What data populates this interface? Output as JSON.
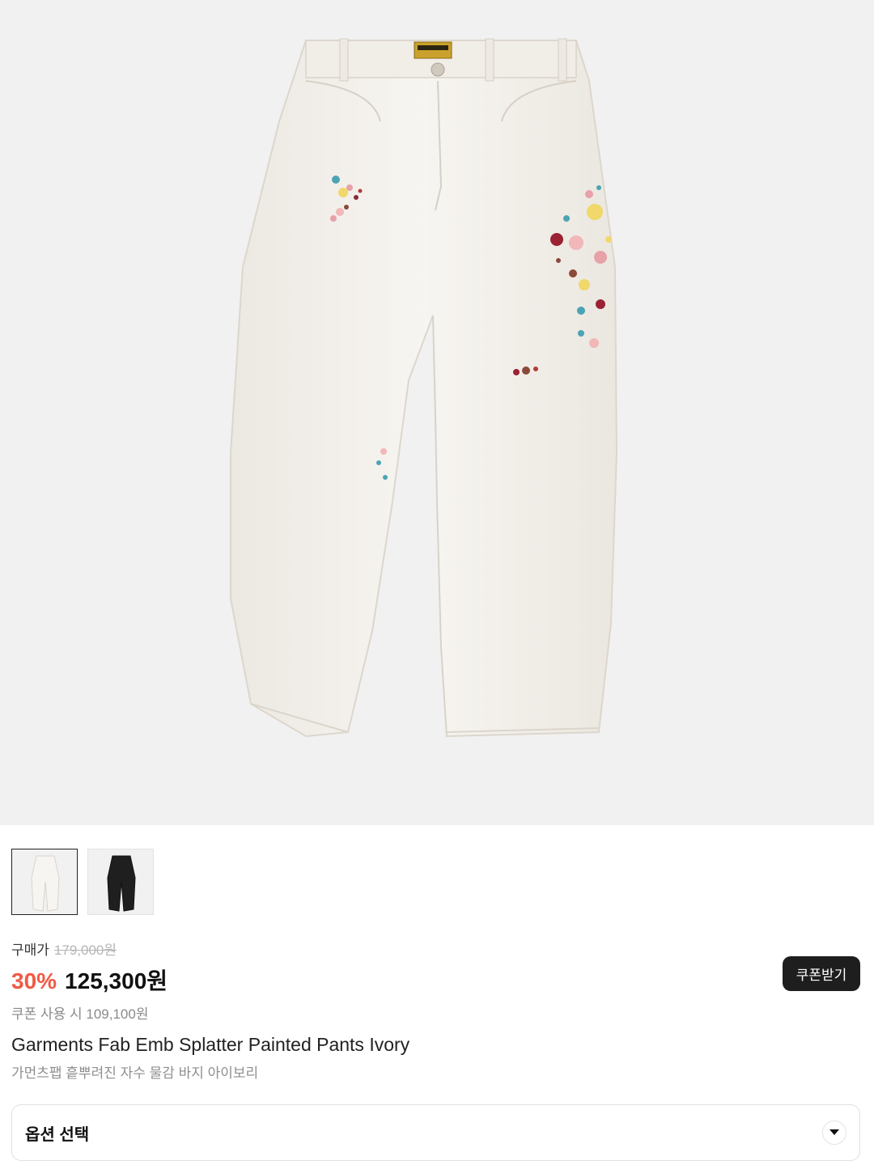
{
  "product": {
    "hero_image": "ivory-splatter-pants-photo",
    "thumbnails": [
      {
        "label": "ivory-variant",
        "active": true
      },
      {
        "label": "black-variant",
        "active": false
      }
    ],
    "purchase_label": "구매가",
    "original_price": "179,000원",
    "discount": "30%",
    "sale_price": "125,300원",
    "coupon_price_text": "쿠폰 사용 시 109,100원",
    "coupon_button_label": "쿠폰받기",
    "name": "Garments Fab Emb Splatter Painted Pants Ivory",
    "name_ko": "가먼츠팹 흩뿌려진 자수 물감 바지 아이보리"
  },
  "options": {
    "label": "옵션 선택",
    "icon": "chevron-down-icon"
  },
  "colors": {
    "hero_bg": "#f2f1f1",
    "discount": "#ef5a44",
    "button_bg": "#1e1e1e",
    "pants_ivory": "#f4f1ec"
  }
}
